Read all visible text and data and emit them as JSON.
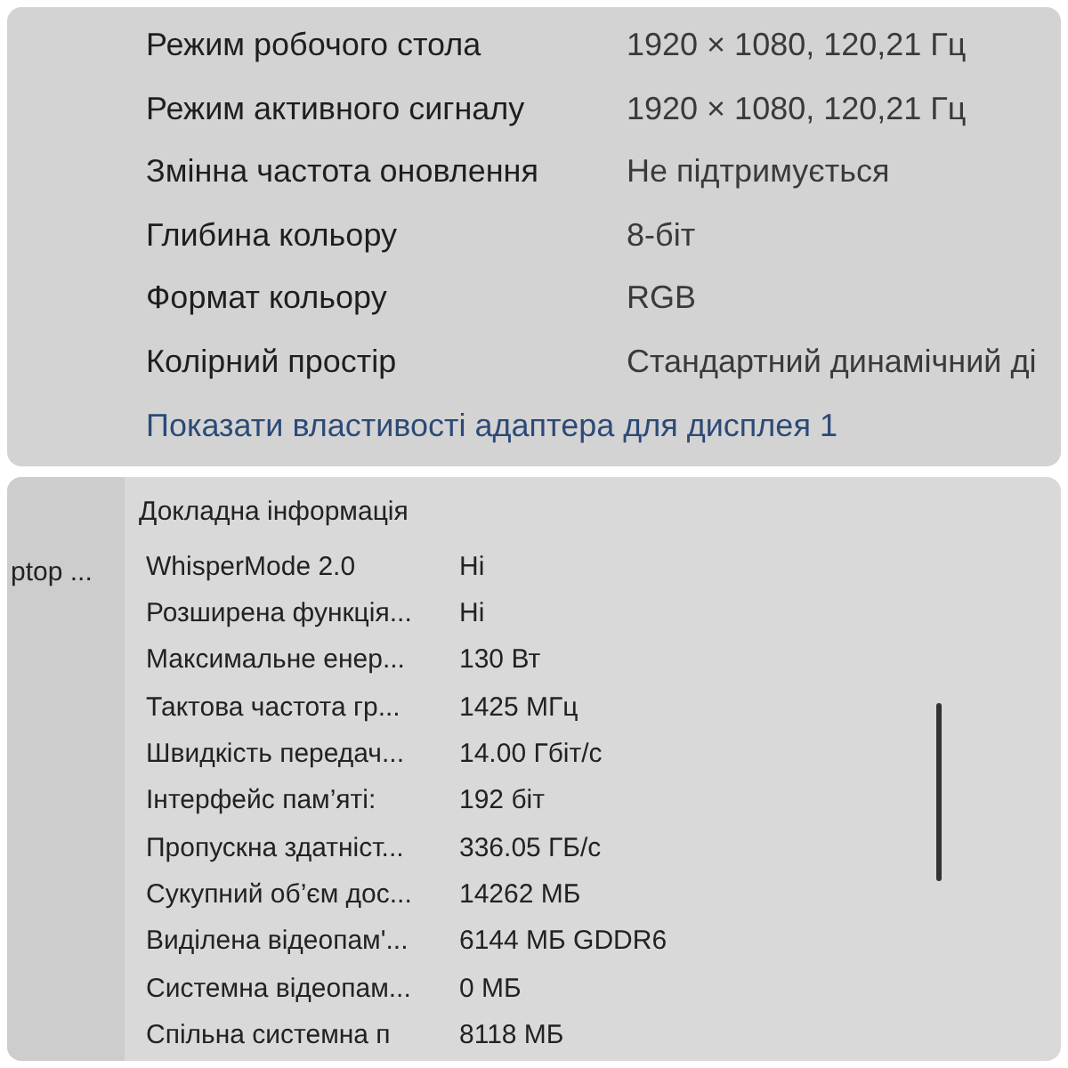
{
  "display_panel": {
    "rows": [
      {
        "label": "Режим робочого стола",
        "value": "1920 × 1080, 120,21 Гц"
      },
      {
        "label": "Режим активного сигналу",
        "value": "1920 × 1080, 120,21 Гц"
      },
      {
        "label": "Змінна частота оновлення",
        "value": "Не підтримується"
      },
      {
        "label": "Глибина кольору",
        "value": "8-біт"
      },
      {
        "label": "Формат кольору",
        "value": "RGB"
      },
      {
        "label": "Колірний простір",
        "value": "Стандартний динамічний ді"
      }
    ],
    "link": "Показати властивості адаптера для дисплея 1"
  },
  "details_panel": {
    "sidebar_item": "ptop ...",
    "heading": "Докладна інформація",
    "rows": [
      {
        "label": "WhisperMode 2.0",
        "value": "Ні"
      },
      {
        "label": "Розширена функція...",
        "value": "Ні"
      },
      {
        "label": "Максимальне енер...",
        "value": "130 Вт"
      },
      {
        "label": "Тактова частота гр...",
        "value": "1425 МГц"
      },
      {
        "label": "Швидкість передач...",
        "value": "14.00 Гбіт/с"
      },
      {
        "label": "Інтерфейс пам’яті:",
        "value": "192 біт"
      },
      {
        "label": "Пропускна здатніст...",
        "value": "336.05 ГБ/с"
      },
      {
        "label": "Сукупний об’єм дос...",
        "value": "14262 МБ"
      },
      {
        "label": "Виділена відеопам'...",
        "value": "6144 МБ GDDR6"
      },
      {
        "label": "Системна відеопам...",
        "value": "0 МБ"
      },
      {
        "label": "Спільна системна п",
        "value": "8118 МБ"
      }
    ]
  }
}
